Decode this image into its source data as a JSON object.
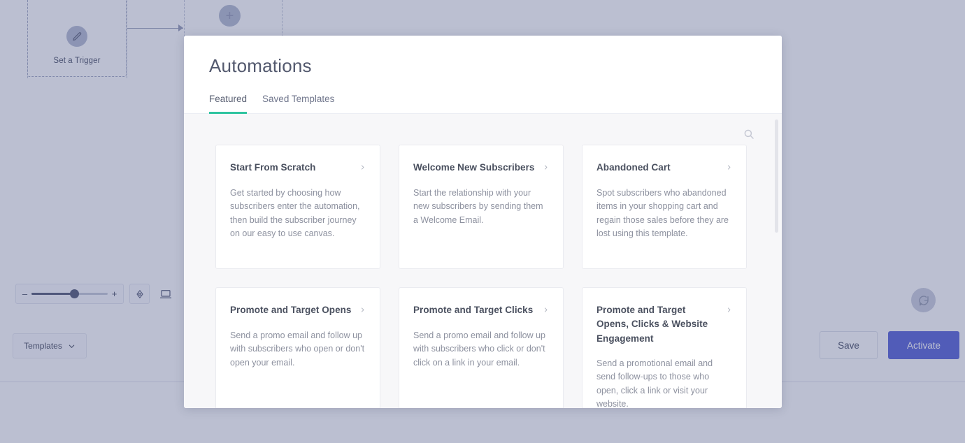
{
  "canvas": {
    "trigger_node": {
      "label": "Set a Trigger",
      "icon": "pencil-icon"
    },
    "add_node": {
      "label": "+",
      "icon": "plus-icon"
    },
    "zoom_controls": {
      "minus_label": "–",
      "plus_label": "+",
      "zoom_value": "54",
      "center_icon": "target-icon",
      "fit_screen_icon": "screen-fit-icon"
    },
    "templates_button": {
      "label": "Templates",
      "icon": "chevron-down-icon"
    },
    "save_button": {
      "label": "Save"
    },
    "activate_button": {
      "label": "Activate"
    },
    "chat_bubble": {
      "icon": "chat-bubble-icon"
    }
  },
  "modal": {
    "title": "Automations",
    "tabs": [
      {
        "label": "Featured",
        "active": true
      },
      {
        "label": "Saved Templates",
        "active": false
      }
    ],
    "search": {
      "icon": "search-icon",
      "placeholder": "Search"
    },
    "cards": [
      {
        "title": "Start From Scratch",
        "description": "Get started by choosing how subscribers enter the automation, then build the subscriber journey on our easy to use canvas.",
        "chevron": "chevron-right-icon"
      },
      {
        "title": "Welcome New Subscribers",
        "description": "Start the relationship with your new subscribers by sending them a Welcome Email.",
        "chevron": "chevron-right-icon"
      },
      {
        "title": "Abandoned Cart",
        "description": "Spot subscribers who abandoned items in your shopping cart and regain those sales before they are lost using this template.",
        "chevron": "chevron-right-icon"
      },
      {
        "title": "Promote and Target Opens",
        "description": "Send a promo email and follow up with subscribers who open or don't open your email.",
        "chevron": "chevron-right-icon"
      },
      {
        "title": "Promote and Target Clicks",
        "description": "Send a promo email and follow up with subscribers who click or don't click on a link in your email.",
        "chevron": "chevron-right-icon"
      },
      {
        "title": "Promote and Target Opens, Clicks & Website Engagement",
        "description": "Send a promotional email and send follow-ups to those who open, click a link or visit your website.",
        "chevron": "chevron-right-icon"
      }
    ]
  },
  "colors": {
    "accent_teal": "#2fc4a0",
    "primary_indigo": "#4f5bd5",
    "modal_body": "#f7f7f9",
    "overlay": "#565e8c"
  }
}
